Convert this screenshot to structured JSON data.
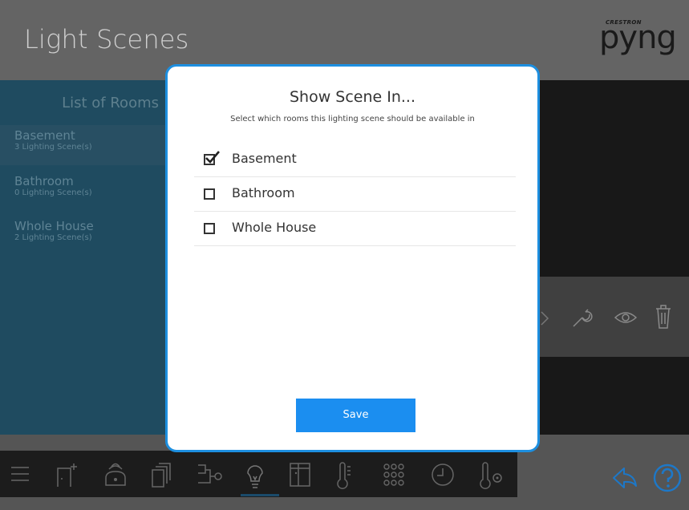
{
  "header": {
    "title": "Light Scenes",
    "logo_small": "CRESTRON",
    "logo_text": "pyng"
  },
  "rooms": {
    "title": "List of Rooms",
    "items": [
      {
        "name": "Basement",
        "count": "3 Lighting Scene(s)"
      },
      {
        "name": "Bathroom",
        "count": "0 Lighting Scene(s)"
      },
      {
        "name": "Whole House",
        "count": "2 Lighting Scene(s)"
      }
    ]
  },
  "scene_row_icons": [
    "chevron-right-icon",
    "wrench-icon",
    "eye-icon",
    "trash-icon"
  ],
  "toolbar": {
    "icons": [
      "menu-icon",
      "add-room-icon",
      "remote-icon",
      "shades-icon",
      "scenes-icon",
      "bulb-icon",
      "door-icon",
      "thermostat-icon",
      "keypad-icon",
      "clock-icon",
      "temperature-sensor-icon"
    ],
    "active": "bulb-icon"
  },
  "corner_icons": [
    "back-icon",
    "help-icon"
  ],
  "modal": {
    "title": "Show Scene In...",
    "subtitle": "Select which rooms this lighting scene should be available in",
    "options": [
      {
        "label": "Basement",
        "checked": true
      },
      {
        "label": "Bathroom",
        "checked": false
      },
      {
        "label": "Whole House",
        "checked": false
      }
    ],
    "save_label": "Save"
  },
  "colors": {
    "modal_border": "#1d8fe0",
    "save_button": "#1b8ef0",
    "rooms_panel": "#1f4b60"
  }
}
